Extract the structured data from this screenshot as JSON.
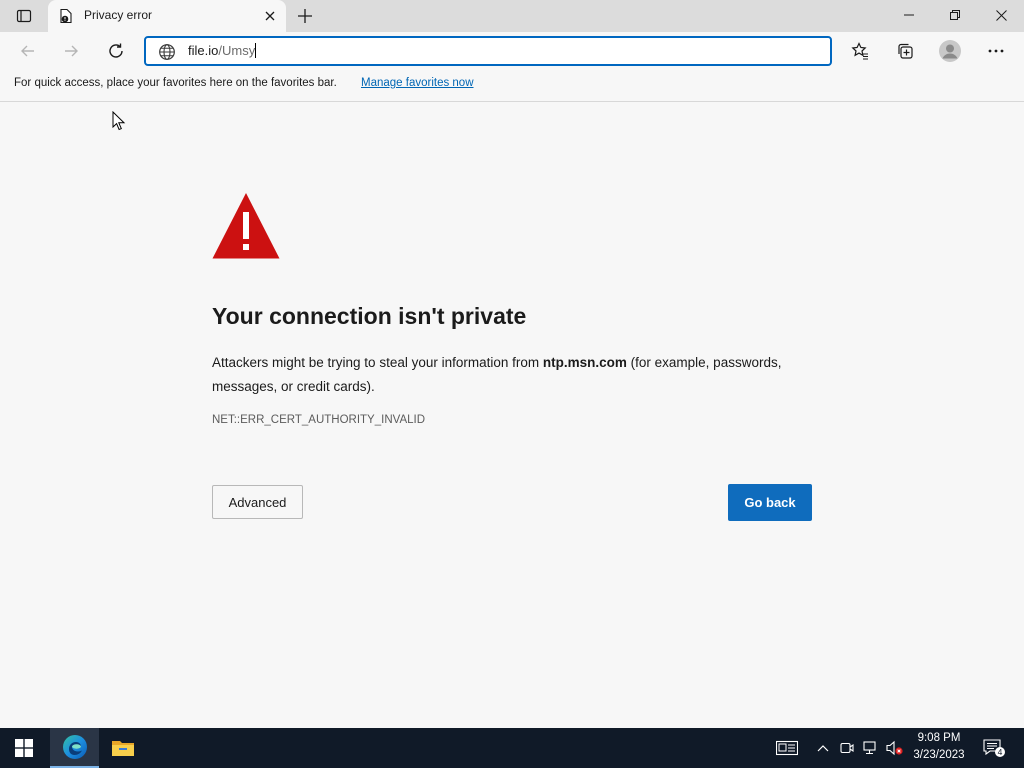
{
  "browser": {
    "tab": {
      "title": "Privacy error"
    },
    "address": {
      "host": "file.io",
      "path": "/Umsy"
    },
    "favorites_bar": {
      "message": "For quick access, place your favorites here on the favorites bar.",
      "link": "Manage favorites now"
    }
  },
  "error_page": {
    "title": "Your connection isn't private",
    "body_prefix": "Attackers might be trying to steal your information from ",
    "body_host": "ntp.msn.com",
    "body_suffix": " (for example, passwords, messages, or credit cards).",
    "error_code": "NET::ERR_CERT_AUTHORITY_INVALID",
    "advanced_button": "Advanced",
    "go_back_button": "Go back"
  },
  "taskbar": {
    "time": "9:08 PM",
    "date": "3/23/2023",
    "notification_count": "4"
  },
  "colors": {
    "accent": "#0f6cbd",
    "warning": "#cc1111",
    "taskbar": "#101a28"
  }
}
